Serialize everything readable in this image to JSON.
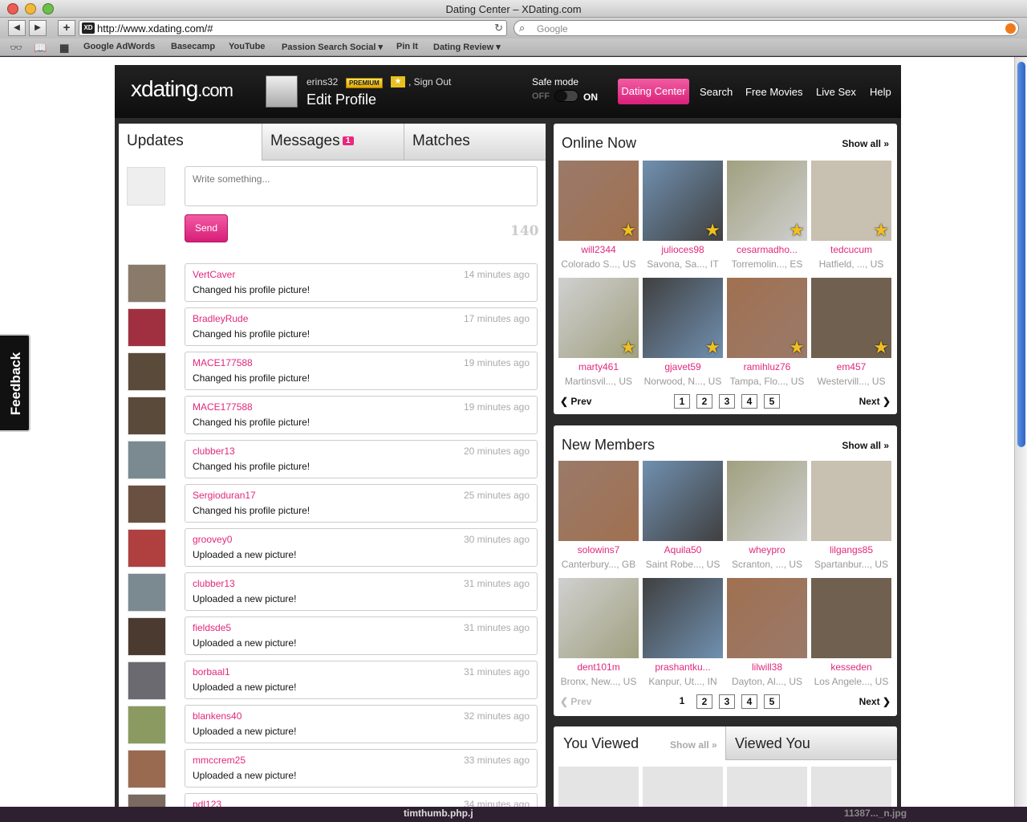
{
  "window": {
    "title": "Dating Center – XDating.com"
  },
  "browser": {
    "url": "http://www.xdating.com/#",
    "search_placeholder": "Google",
    "bookmarks": [
      "Google AdWords",
      "Basecamp",
      "YouTube",
      "Passion Search Social ▾",
      "Pin It",
      "Dating Review ▾"
    ]
  },
  "feedback_label": "Feedback",
  "header": {
    "logo_main": "xdating",
    "logo_suffix": ".com",
    "username": "erins32",
    "premium_badge": "PREMIUM",
    "sign_out": ", Sign Out",
    "edit_profile": "Edit Profile",
    "safe_mode_label": "Safe mode",
    "safe_off": "OFF",
    "safe_on": "ON",
    "nav": [
      "Dating Center",
      "Search",
      "Free Movies",
      "Live Sex",
      "Help"
    ]
  },
  "left": {
    "tabs": {
      "updates": "Updates",
      "messages": "Messages",
      "messages_count": "1",
      "matches": "Matches"
    },
    "composer": {
      "placeholder": "Write something...",
      "send": "Send",
      "char_count": "140"
    },
    "feed": [
      {
        "user": "VertCaver",
        "time": "14 minutes ago",
        "action": "Changed his profile picture!"
      },
      {
        "user": "BradleyRude",
        "time": "17 minutes ago",
        "action": "Changed his profile picture!"
      },
      {
        "user": "MACE177588",
        "time": "19 minutes ago",
        "action": "Changed his profile picture!"
      },
      {
        "user": "MACE177588",
        "time": "19 minutes ago",
        "action": "Changed his profile picture!"
      },
      {
        "user": "clubber13",
        "time": "20 minutes ago",
        "action": "Changed his profile picture!"
      },
      {
        "user": "Sergioduran17",
        "time": "25 minutes ago",
        "action": "Changed his profile picture!"
      },
      {
        "user": "groovey0",
        "time": "30 minutes ago",
        "action": "Uploaded a new picture!"
      },
      {
        "user": "clubber13",
        "time": "31 minutes ago",
        "action": "Uploaded a new picture!"
      },
      {
        "user": "fieldsde5",
        "time": "31 minutes ago",
        "action": "Uploaded a new picture!"
      },
      {
        "user": "borbaal1",
        "time": "31 minutes ago",
        "action": "Uploaded a new picture!"
      },
      {
        "user": "blankens40",
        "time": "32 minutes ago",
        "action": "Uploaded a new picture!"
      },
      {
        "user": "mmccrem25",
        "time": "33 minutes ago",
        "action": "Uploaded a new picture!"
      },
      {
        "user": "pdl123",
        "time": "34 minutes ago",
        "action": ""
      }
    ]
  },
  "online_now": {
    "title": "Online Now",
    "show_all": "Show all »",
    "members": [
      {
        "name": "will2344",
        "loc": "Colorado S..., US"
      },
      {
        "name": "julioces98",
        "loc": "Savona, Sa..., IT"
      },
      {
        "name": "cesarmadho...",
        "loc": "Torremolin..., ES"
      },
      {
        "name": "tedcucum",
        "loc": "Hatfield, ..., US"
      },
      {
        "name": "marty461",
        "loc": "Martinsvil..., US"
      },
      {
        "name": "gjavet59",
        "loc": "Norwood, N..., US"
      },
      {
        "name": "ramihluz76",
        "loc": "Tampa, Flo..., US"
      },
      {
        "name": "em457",
        "loc": "Westervill..., US"
      }
    ],
    "pager": {
      "prev": "Prev",
      "next": "Next",
      "pages": [
        "1",
        "2",
        "3",
        "4",
        "5"
      ],
      "current": "1"
    }
  },
  "new_members": {
    "title": "New Members",
    "show_all": "Show all »",
    "members": [
      {
        "name": "solowins7",
        "loc": "Canterbury..., GB"
      },
      {
        "name": "Aquila50",
        "loc": "Saint Robe..., US"
      },
      {
        "name": "wheypro",
        "loc": "Scranton, ..., US"
      },
      {
        "name": "lilgangs85",
        "loc": "Spartanbur..., US"
      },
      {
        "name": "dent101m",
        "loc": "Bronx, New..., US"
      },
      {
        "name": "prashantku...",
        "loc": "Kanpur, Ut..., IN"
      },
      {
        "name": "lilwill38",
        "loc": "Dayton, Al..., US"
      },
      {
        "name": "kesseden",
        "loc": "Los Angele..., US"
      }
    ],
    "pager": {
      "prev": "Prev",
      "next": "Next",
      "pages": [
        "1",
        "2",
        "3",
        "4",
        "5"
      ],
      "current": "1"
    }
  },
  "viewed": {
    "you_viewed": "You Viewed",
    "show_all": "Show all »",
    "viewed_you": "Viewed You"
  },
  "downloads": [
    "timthumb.php.j",
    "11387..._n.jpg"
  ]
}
